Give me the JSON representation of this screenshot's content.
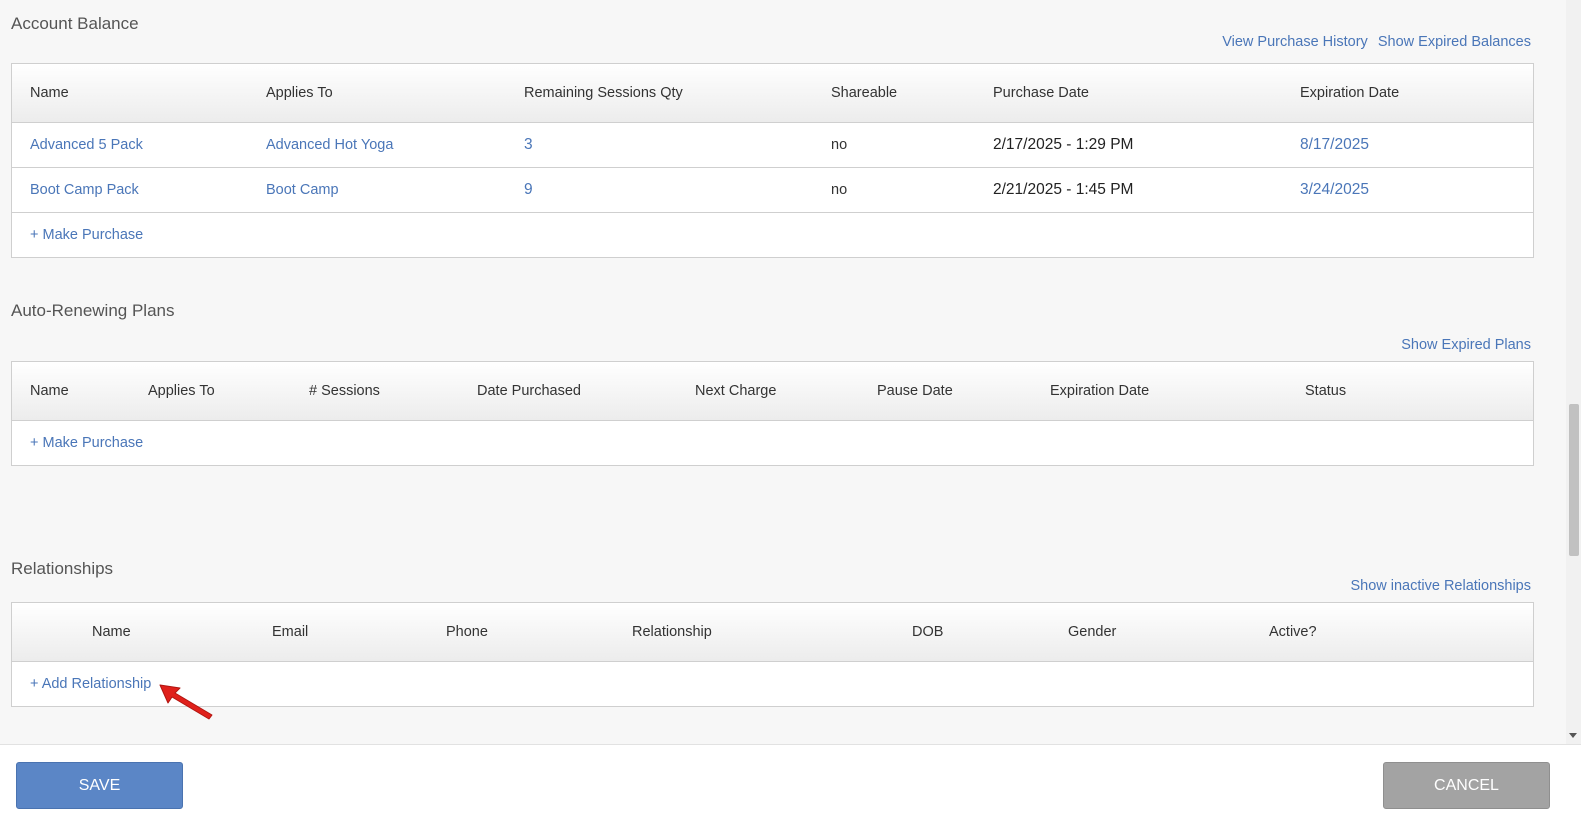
{
  "account_balance": {
    "title": "Account Balance",
    "links": [
      "View Purchase History",
      "Show Expired Balances"
    ],
    "columns": [
      "Name",
      "Applies To",
      "Remaining Sessions Qty",
      "Shareable",
      "Purchase Date",
      "Expiration Date"
    ],
    "rows": [
      {
        "name": "Advanced 5 Pack",
        "applies_to": "Advanced Hot Yoga",
        "remaining": "3",
        "shareable": "no",
        "purchase_date": "2/17/2025 - 1:29 PM",
        "expiration_date": "8/17/2025"
      },
      {
        "name": "Boot Camp Pack",
        "applies_to": "Boot Camp",
        "remaining": "9",
        "shareable": "no",
        "purchase_date": "2/21/2025 - 1:45 PM",
        "expiration_date": "3/24/2025"
      }
    ],
    "action": "+ Make Purchase"
  },
  "auto_renewing": {
    "title": "Auto-Renewing Plans",
    "links": [
      "Show Expired Plans"
    ],
    "columns": [
      "Name",
      "Applies To",
      "# Sessions",
      "Date Purchased",
      "Next Charge",
      "Pause Date",
      "Expiration Date",
      "Status"
    ],
    "action": "+ Make Purchase"
  },
  "relationships": {
    "title": "Relationships",
    "links": [
      "Show inactive Relationships"
    ],
    "columns": [
      "Name",
      "Email",
      "Phone",
      "Relationship",
      "DOB",
      "Gender",
      "Active?"
    ],
    "action": "+ Add Relationship"
  },
  "footer": {
    "save_label": "SAVE",
    "cancel_label": "CANCEL"
  },
  "colors": {
    "link": "#4a76b8",
    "save": "#5b86c6",
    "cancel": "#a3a3a3",
    "annotation_arrow": "#e0201b"
  }
}
